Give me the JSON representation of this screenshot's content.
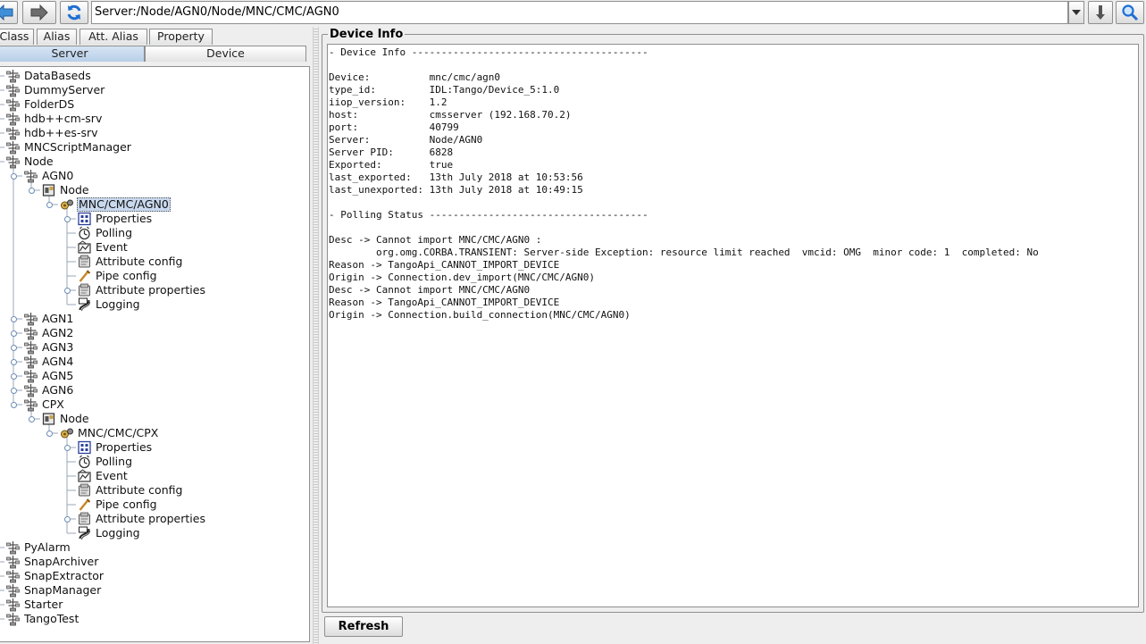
{
  "toolbar": {
    "address": "Server:/Node/AGN0/Node/MNC/CMC/AGN0"
  },
  "left_tabs": {
    "row1": [
      "Class",
      "Alias",
      "Att. Alias",
      "Property"
    ],
    "row2": [
      "Server",
      "Device"
    ]
  },
  "tree": [
    {
      "label": "DataBaseds",
      "icon": "server-icon"
    },
    {
      "label": "DummyServer",
      "icon": "server-icon"
    },
    {
      "label": "FolderDS",
      "icon": "server-icon"
    },
    {
      "label": "hdb++cm-srv",
      "icon": "server-icon"
    },
    {
      "label": "hdb++es-srv",
      "icon": "server-icon"
    },
    {
      "label": "MNCScriptManager",
      "icon": "server-icon"
    },
    {
      "label": "Node",
      "icon": "server-icon"
    },
    {
      "label": "AGN0",
      "icon": "server-icon"
    },
    {
      "label": "Node",
      "icon": "class-icon"
    },
    {
      "label": "MNC/CMC/AGN0",
      "icon": "device-icon"
    },
    {
      "label": "Properties",
      "icon": "properties-icon"
    },
    {
      "label": "Polling",
      "icon": "polling-icon"
    },
    {
      "label": "Event",
      "icon": "event-icon"
    },
    {
      "label": "Attribute config",
      "icon": "attribute-config-icon"
    },
    {
      "label": "Pipe config",
      "icon": "pipe-config-icon"
    },
    {
      "label": "Attribute properties",
      "icon": "attribute-properties-icon"
    },
    {
      "label": "Logging",
      "icon": "logging-icon"
    },
    {
      "label": "AGN1",
      "icon": "server-icon"
    },
    {
      "label": "AGN2",
      "icon": "server-icon"
    },
    {
      "label": "AGN3",
      "icon": "server-icon"
    },
    {
      "label": "AGN4",
      "icon": "server-icon"
    },
    {
      "label": "AGN5",
      "icon": "server-icon"
    },
    {
      "label": "AGN6",
      "icon": "server-icon"
    },
    {
      "label": "CPX",
      "icon": "server-icon"
    },
    {
      "label": "Node",
      "icon": "class-icon"
    },
    {
      "label": "MNC/CMC/CPX",
      "icon": "device-icon"
    },
    {
      "label": "Properties",
      "icon": "properties-icon"
    },
    {
      "label": "Polling",
      "icon": "polling-icon"
    },
    {
      "label": "Event",
      "icon": "event-icon"
    },
    {
      "label": "Attribute config",
      "icon": "attribute-config-icon"
    },
    {
      "label": "Pipe config",
      "icon": "pipe-config-icon"
    },
    {
      "label": "Attribute properties",
      "icon": "attribute-properties-icon"
    },
    {
      "label": "Logging",
      "icon": "logging-icon"
    },
    {
      "label": "PyAlarm",
      "icon": "server-icon"
    },
    {
      "label": "SnapArchiver",
      "icon": "server-icon"
    },
    {
      "label": "SnapExtractor",
      "icon": "server-icon"
    },
    {
      "label": "SnapManager",
      "icon": "server-icon"
    },
    {
      "label": "Starter",
      "icon": "server-icon"
    },
    {
      "label": "TangoTest",
      "icon": "server-icon"
    }
  ],
  "device_info": {
    "title": "Device Info",
    "lines": [
      "- Device Info ----------------------------------------",
      "",
      "Device:          mnc/cmc/agn0",
      "type_id:         IDL:Tango/Device_5:1.0",
      "iiop_version:    1.2",
      "host:            cmsserver (192.168.70.2)",
      "port:            40799",
      "Server:          Node/AGN0",
      "Server PID:      6828",
      "Exported:        true",
      "last_exported:   13th July 2018 at 10:53:56",
      "last_unexported: 13th July 2018 at 10:49:15",
      "",
      "- Polling Status -------------------------------------",
      "",
      "Desc -> Cannot import MNC/CMC/AGN0 :",
      "        org.omg.CORBA.TRANSIENT: Server-side Exception: resource limit reached  vmcid: OMG  minor code: 1  completed: No",
      "Reason -> TangoApi_CANNOT_IMPORT_DEVICE",
      "Origin -> Connection.dev_import(MNC/CMC/AGN0)",
      "Desc -> Cannot import MNC/CMC/AGN0",
      "Reason -> TangoApi_CANNOT_IMPORT_DEVICE",
      "Origin -> Connection.build_connection(MNC/CMC/AGN0)"
    ],
    "refresh_label": "Refresh"
  }
}
